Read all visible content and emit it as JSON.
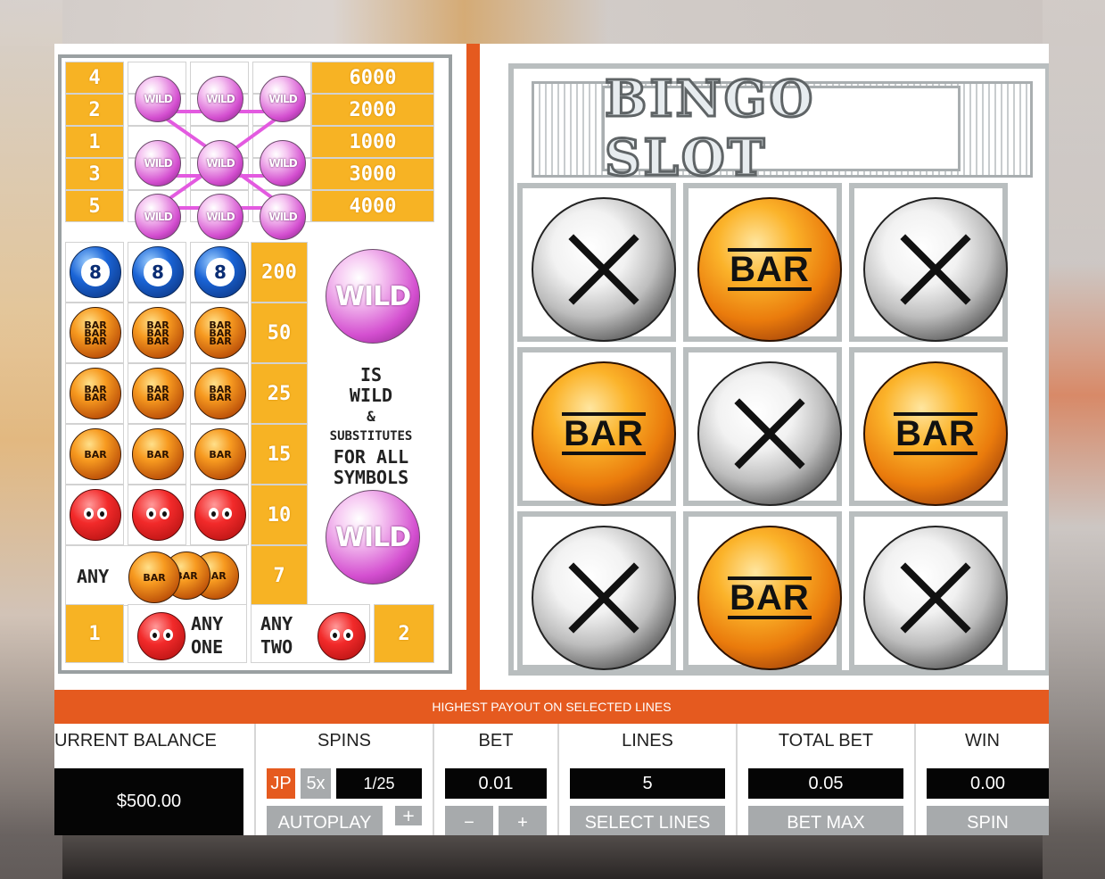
{
  "paytable": {
    "line_numbers": [
      "4",
      "2",
      "1",
      "3",
      "5"
    ],
    "line_payouts": [
      "6000",
      "2000",
      "1000",
      "3000",
      "4000"
    ],
    "wild_ball_label": "WILD",
    "eight_label": "8",
    "bar_label": "BAR",
    "combo_payouts": [
      "200",
      "50",
      "25",
      "15",
      "10",
      "7"
    ],
    "any_label": "ANY",
    "wild_text": [
      "IS",
      "WILD",
      "&",
      "SUBSTITUTES",
      "FOR ALL",
      "SYMBOLS"
    ],
    "any_one": {
      "count": "1",
      "line1": "ANY",
      "line2": "ONE"
    },
    "any_two": {
      "count": "2",
      "line1": "ANY",
      "line2": "TWO"
    }
  },
  "reels": {
    "title": "BINGO SLOT",
    "grid": [
      [
        "X",
        "BAR",
        "X"
      ],
      [
        "BAR",
        "X",
        "BAR"
      ],
      [
        "X",
        "BAR",
        "X"
      ]
    ],
    "bar_label": "BAR"
  },
  "bottom": {
    "payout_strip": "HIGHEST PAYOUT ON SELECTED LINES",
    "balance": {
      "label": "URRENT BALANCE",
      "value": "$500.00"
    },
    "spins": {
      "label": "SPINS",
      "jp": "JP",
      "x5": "5x",
      "count": "1/25",
      "autoplay": "AUTOPLAY",
      "plus": "+"
    },
    "bet": {
      "label": "BET",
      "value": "0.01",
      "minus": "−",
      "plus": "+"
    },
    "lines": {
      "label": "LINES",
      "value": "5",
      "button": "SELECT LINES"
    },
    "total_bet": {
      "label": "TOTAL BET",
      "value": "0.05",
      "button": "BET MAX"
    },
    "win": {
      "label": "WIN",
      "value": "0.00",
      "button": "SPIN"
    }
  },
  "colors": {
    "accent": "#e55a1f",
    "payout_yellow": "#f7b324",
    "wild_pink": "#d44fd0"
  }
}
